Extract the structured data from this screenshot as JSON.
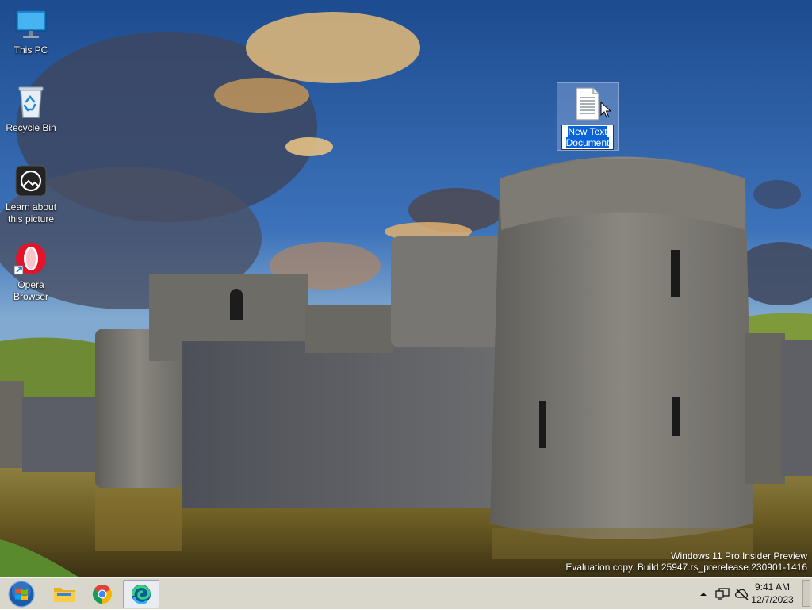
{
  "desktop_icons": [
    {
      "label": "This PC",
      "icon": "monitor-icon"
    },
    {
      "label": "Recycle Bin",
      "icon": "recycle-bin-icon"
    },
    {
      "label": "Learn about\nthis picture",
      "icon": "camera-info-icon"
    },
    {
      "label": "Opera\nBrowser",
      "icon": "opera-logo-icon"
    }
  ],
  "selected_file": {
    "icon": "text-document-icon",
    "rename_value": "New Text\nDocument"
  },
  "watermark": {
    "line1": "Windows 11 Pro Insider Preview",
    "line2": "Evaluation copy. Build 25947.rs_prerelease.230901-1416"
  },
  "taskbar": {
    "start_icon": "windows-orb-icon",
    "pinned": [
      {
        "name": "File Explorer",
        "icon": "folder-icon"
      },
      {
        "name": "Google Chrome",
        "icon": "chrome-icon"
      },
      {
        "name": "Microsoft Edge",
        "icon": "edge-icon",
        "active": true
      }
    ],
    "tray_icons": [
      "chevron-up-icon",
      "network-icon",
      "cloud-offline-icon"
    ],
    "clock": {
      "time": "9:41 AM",
      "date": "12/7/2023"
    }
  },
  "colors": {
    "selection": "#0a64d8",
    "taskbar_bg": "#d9d6cc",
    "opera_red": "#e5132a"
  }
}
